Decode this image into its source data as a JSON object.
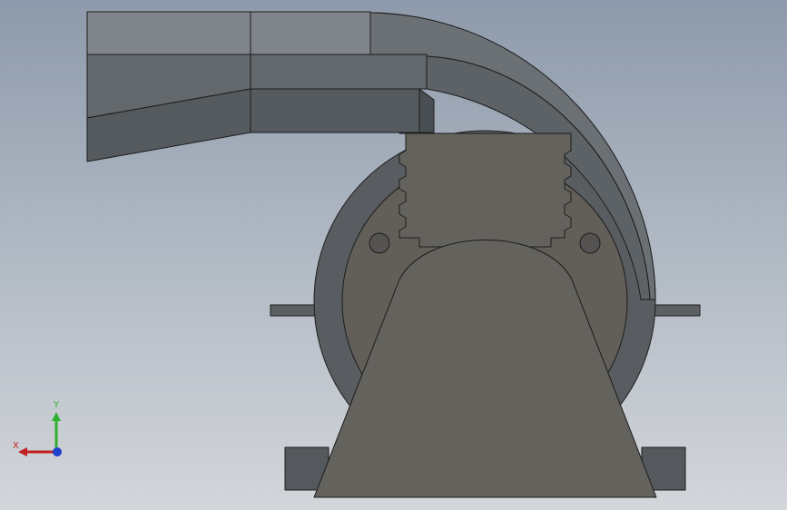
{
  "viewport": {
    "background_top": "#8e9aab",
    "background_bottom": "#d3d6da"
  },
  "model": {
    "part_colors": {
      "duct_top": "#7f858a",
      "duct_mid": "#63686c",
      "duct_dark": "#545a5e",
      "housing": "#5a5e62",
      "bracket": "#626058",
      "edges": "#1c1c1c"
    }
  },
  "triad": {
    "x_label": "X",
    "y_label": "Y",
    "x_color": "#c02020",
    "y_color": "#2fb02f",
    "z_color": "#2040d0"
  }
}
